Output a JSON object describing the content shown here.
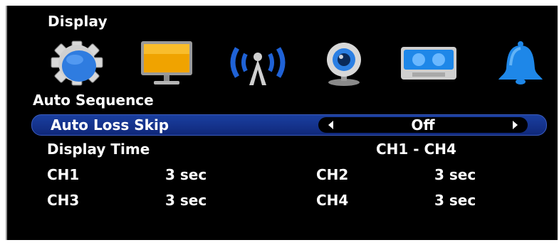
{
  "menu": {
    "title": "Display",
    "icons": [
      {
        "name": "gear-icon",
        "color": "#2f7ce0"
      },
      {
        "name": "monitor-icon",
        "color": "#f0a300"
      },
      {
        "name": "network-icon",
        "color": "#1f62d6"
      },
      {
        "name": "camera-icon",
        "color": "#2b7fe3"
      },
      {
        "name": "recorder-icon",
        "color": "#1e87e8"
      },
      {
        "name": "bell-icon",
        "color": "#1e87e8"
      }
    ],
    "section": "Auto Sequence",
    "selected_setting": {
      "label": "Auto Loss Skip",
      "value": "Off"
    },
    "display_time": {
      "label": "Display Time",
      "range": "CH1 - CH4"
    },
    "channels": [
      {
        "name": "CH1",
        "time": "3 sec"
      },
      {
        "name": "CH2",
        "time": "3 sec"
      },
      {
        "name": "CH3",
        "time": "3 sec"
      },
      {
        "name": "CH4",
        "time": "3 sec"
      }
    ]
  },
  "colors": {
    "background": "#000000",
    "selection": "#143490",
    "text": "#ffffff"
  }
}
